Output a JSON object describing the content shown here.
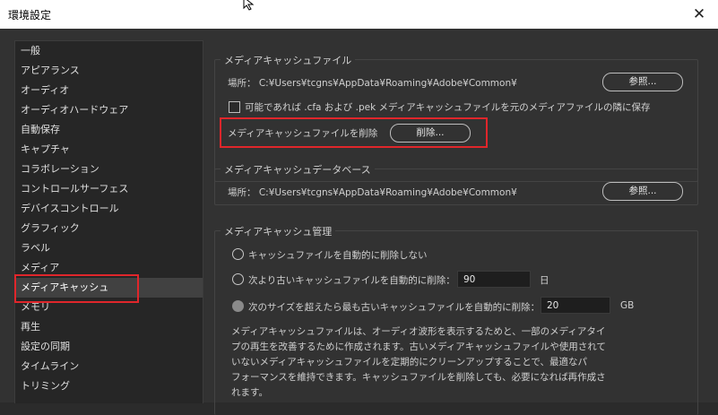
{
  "window": {
    "title": "環境設定",
    "close_symbol": "✕"
  },
  "sidebar": {
    "items": [
      {
        "label": "一般"
      },
      {
        "label": "アピアランス"
      },
      {
        "label": "オーディオ"
      },
      {
        "label": "オーディオハードウェア"
      },
      {
        "label": "自動保存"
      },
      {
        "label": "キャプチャ"
      },
      {
        "label": "コラボレーション"
      },
      {
        "label": "コントロールサーフェス"
      },
      {
        "label": "デバイスコントロール"
      },
      {
        "label": "グラフィック"
      },
      {
        "label": "ラベル"
      },
      {
        "label": "メディア"
      },
      {
        "label": "メディアキャッシュ"
      },
      {
        "label": "メモリ"
      },
      {
        "label": "再生"
      },
      {
        "label": "設定の同期"
      },
      {
        "label": "タイムライン"
      },
      {
        "label": "トリミング"
      }
    ],
    "selected": "メディアキャッシュ"
  },
  "cache_files": {
    "legend": "メディアキャッシュファイル",
    "location": "場所：  C:¥Users¥tcgns¥AppData¥Roaming¥Adobe¥Common¥",
    "browse_label": "参照...",
    "save_next_label": "可能であれば .cfa および .pek メディアキャッシュファイルを元のメディアファイルの隣に保存",
    "save_next_checked": false,
    "delete_text": "メディアキャッシュファイルを削除",
    "delete_button": "削除..."
  },
  "cache_db": {
    "legend": "メディアキャッシュデータベース",
    "location": "場所：  C:¥Users¥tcgns¥AppData¥Roaming¥Adobe¥Common¥",
    "browse_label": "参照..."
  },
  "cache_management": {
    "legend": "メディアキャッシュ管理",
    "option1": "キャッシュファイルを自動的に削除しない",
    "option2": "次より古いキャッシュファイルを自動的に削除：",
    "option2_value": "90",
    "option2_unit": "日",
    "option3": "次のサイズを超えたら最も古いキャッシュファイルを自動的に削除：",
    "option3_value": "20",
    "option3_unit": "GB",
    "selected_option": 3,
    "description": [
      "メディアキャッシュファイルは、オーディオ波形を表示するためと、一部のメディアタイ",
      "プの再生を改善するために作成されます。古いメディアキャッシュファイルや使用されて",
      "いないメディアキャッシュファイルを定期的にクリーンアップすることで、最適なパ",
      "フォーマンスを維持できます。キャッシュファイルを削除しても、必要になれば再作成さ",
      "れます。"
    ]
  },
  "colors": {
    "highlight": "#e0262b",
    "panel_bg": "#323232",
    "sidebar_bg": "#262626"
  }
}
